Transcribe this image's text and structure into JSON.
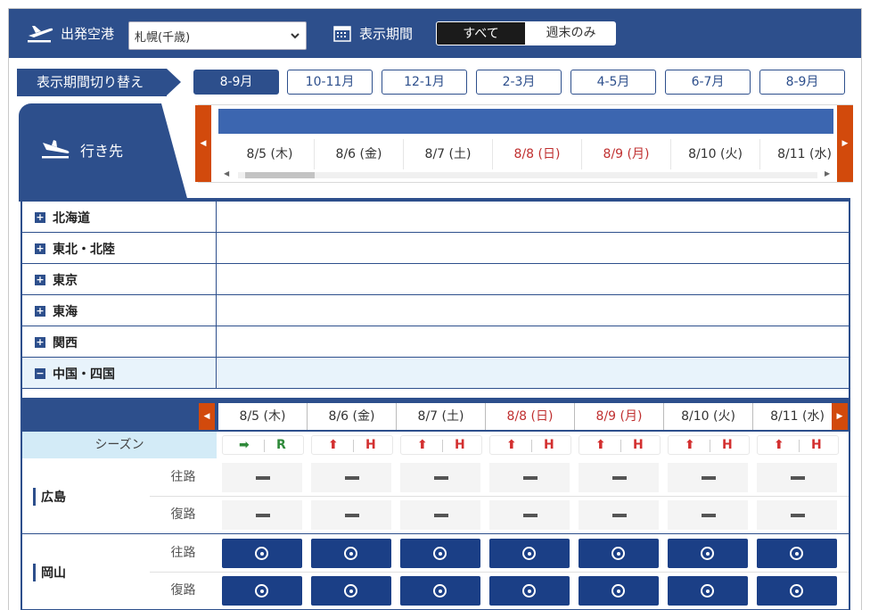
{
  "topbar": {
    "origin_label": "出発空港",
    "origin_value": "札幌(千歳)",
    "period_label": "表示期間",
    "seg_all": "すべて",
    "seg_weekend": "週末のみ"
  },
  "period_switch": {
    "label": "表示期間切り替え",
    "tabs": [
      "8-9月",
      "10-11月",
      "12-1月",
      "2-3月",
      "4-5月",
      "6-7月",
      "8-9月"
    ],
    "active_index": 0
  },
  "destination_label": "行き先",
  "dates": [
    {
      "label": "8/5 (木)",
      "holiday": false
    },
    {
      "label": "8/6 (金)",
      "holiday": false
    },
    {
      "label": "8/7 (土)",
      "holiday": false
    },
    {
      "label": "8/8 (日)",
      "holiday": true
    },
    {
      "label": "8/9 (月)",
      "holiday": true
    },
    {
      "label": "8/10 (火)",
      "holiday": false
    },
    {
      "label": "8/11 (水)",
      "holiday": false
    }
  ],
  "regions": [
    {
      "name": "北海道",
      "expanded": false,
      "toggle": "+"
    },
    {
      "name": "東北・北陸",
      "expanded": false,
      "toggle": "+"
    },
    {
      "name": "東京",
      "expanded": false,
      "toggle": "+"
    },
    {
      "name": "東海",
      "expanded": false,
      "toggle": "+"
    },
    {
      "name": "関西",
      "expanded": false,
      "toggle": "+"
    },
    {
      "name": "中国・四国",
      "expanded": true,
      "toggle": "−"
    }
  ],
  "season": {
    "label": "シーズン",
    "cells": [
      {
        "arrow": "➡",
        "code": "R",
        "color": "green"
      },
      {
        "arrow": "⬆",
        "code": "H",
        "color": "red"
      },
      {
        "arrow": "⬆",
        "code": "H",
        "color": "red"
      },
      {
        "arrow": "⬆",
        "code": "H",
        "color": "red"
      },
      {
        "arrow": "⬆",
        "code": "H",
        "color": "red"
      },
      {
        "arrow": "⬆",
        "code": "H",
        "color": "red"
      },
      {
        "arrow": "⬆",
        "code": "H",
        "color": "red"
      }
    ]
  },
  "cities": [
    {
      "name": "広島",
      "outbound": "往路",
      "return": "復路",
      "status": "none"
    },
    {
      "name": "岡山",
      "outbound": "往路",
      "return": "復路",
      "status": "available"
    }
  ],
  "colors": {
    "brand": "#2d4f8c",
    "holiday": "#c03030",
    "scroll_button": "#d24a0c"
  }
}
